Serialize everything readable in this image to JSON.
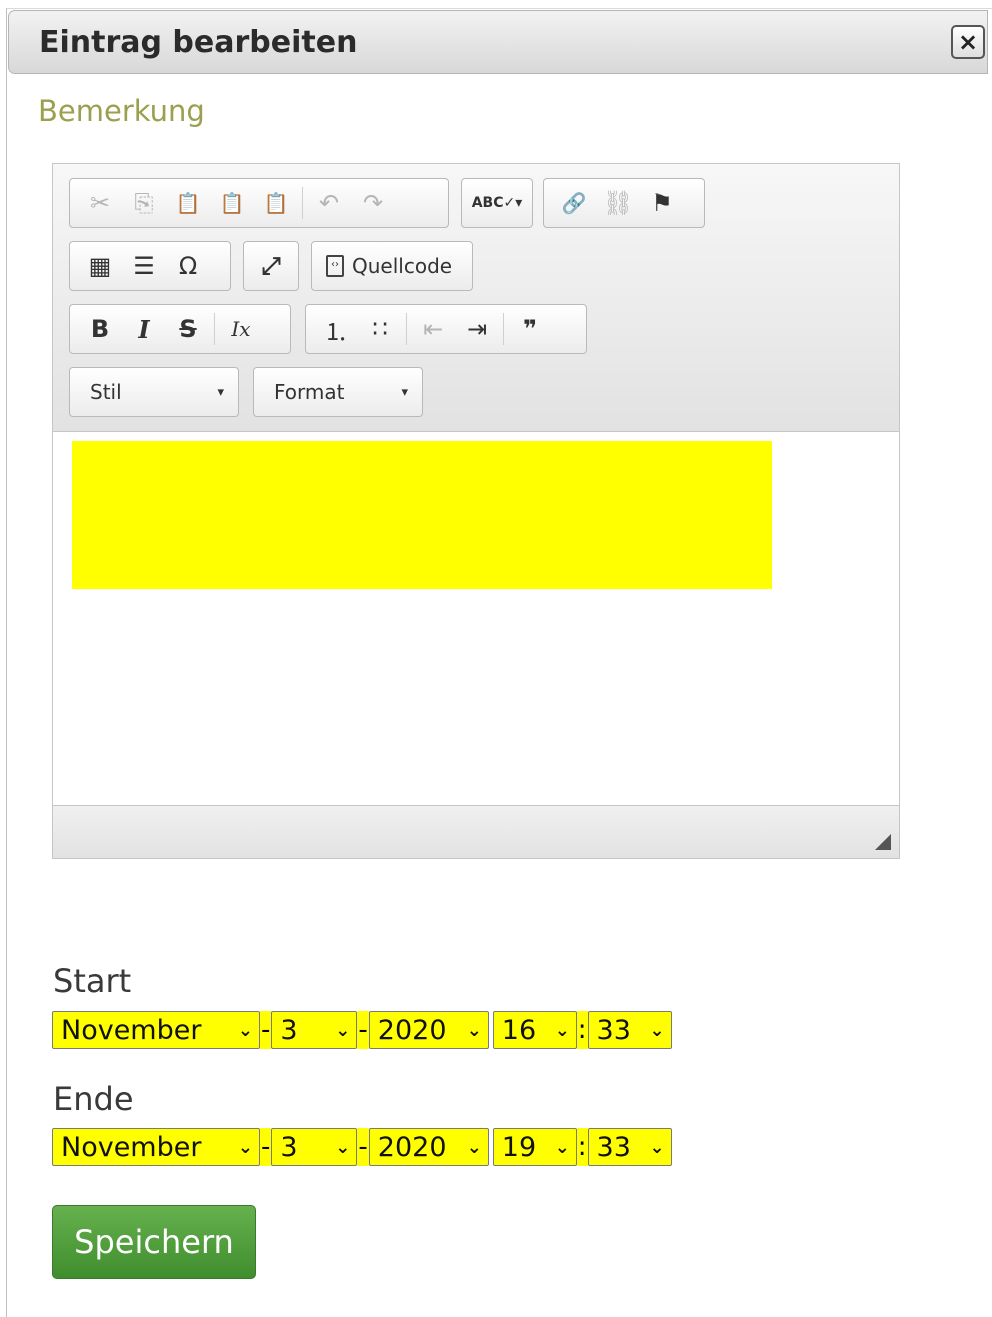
{
  "dialog": {
    "title": "Eintrag bearbeiten",
    "close_icon": "×"
  },
  "section_label": "Bemerkung",
  "toolbar": {
    "row1_group1": [
      {
        "name": "cut-icon",
        "glyph": "✂",
        "disabled": true
      },
      {
        "name": "copy-icon",
        "glyph": "⎘",
        "disabled": true
      },
      {
        "name": "paste-icon",
        "glyph": "📋",
        "disabled": false
      },
      {
        "name": "paste-text-icon",
        "glyph": "📋",
        "disabled": false
      },
      {
        "name": "paste-word-icon",
        "glyph": "📋",
        "disabled": false
      },
      {
        "name": "undo-icon",
        "glyph": "↶",
        "disabled": true
      },
      {
        "name": "redo-icon",
        "glyph": "↷",
        "disabled": true
      }
    ],
    "spellcheck_glyph": "ABC✓▾",
    "link_glyph": "🔗",
    "unlink_glyph": "⛓",
    "anchor_glyph": "⚑",
    "table_glyph": "▦",
    "hr_glyph": "☰",
    "special_char_glyph": "Ω",
    "maximize_glyph": "⤢",
    "source_label": "Quellcode",
    "bold_glyph": "B",
    "italic_glyph": "I",
    "strike_glyph": "S",
    "remove_format_glyph": "Ix",
    "ordered_list_glyph": "⒈",
    "bullet_list_glyph": "∷",
    "outdent_glyph": "⇤",
    "indent_glyph": "⇥",
    "blockquote_glyph": "❞",
    "style_combo": "Stil",
    "format_combo": "Format",
    "combo_arrow": "▾"
  },
  "start": {
    "label": "Start",
    "month": "November",
    "day": "3",
    "year": "2020",
    "hour": "16",
    "minute": "33"
  },
  "end": {
    "label": "Ende",
    "month": "November",
    "day": "3",
    "year": "2020",
    "hour": "19",
    "minute": "33"
  },
  "separators": {
    "date": "-",
    "time": ":"
  },
  "chevron": "⌄",
  "save_label": "Speichern",
  "colors": {
    "highlight": "#ffff00",
    "save_button": "#4a9a37",
    "section_label": "#9aa04e"
  }
}
